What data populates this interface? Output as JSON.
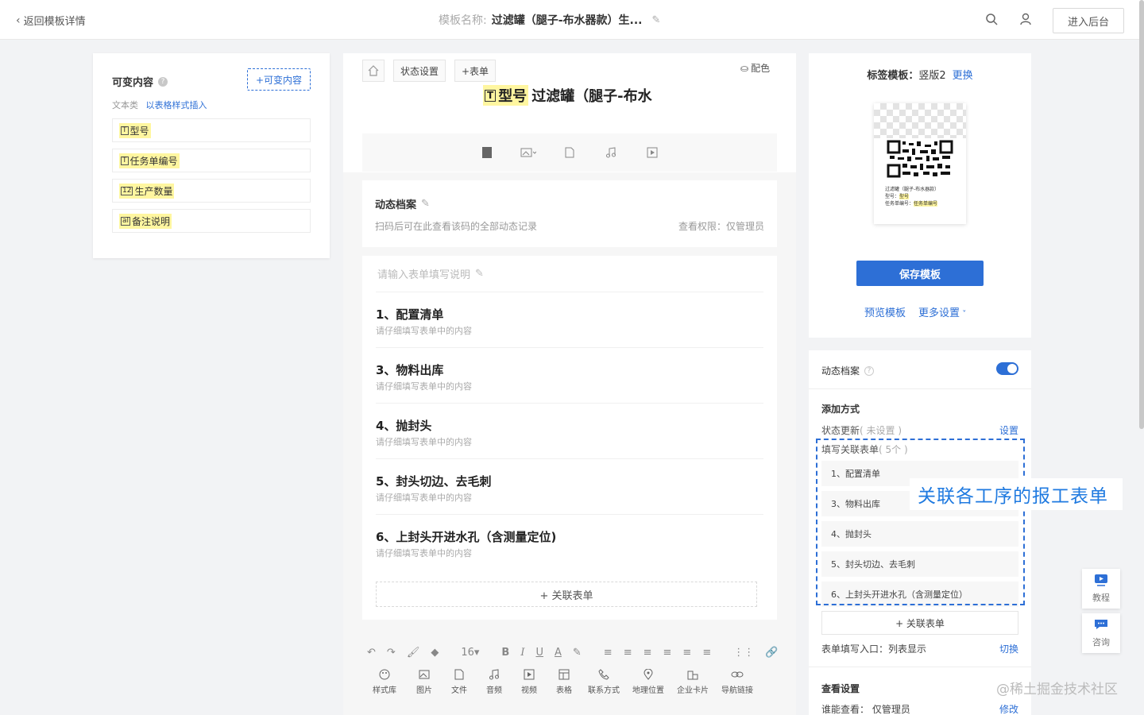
{
  "header": {
    "back_label": "返回模板详情",
    "template_name_label": "模板名称:",
    "template_name": "过滤罐（腿子-布水器款）生...",
    "enter_admin": "进入后台"
  },
  "variables_panel": {
    "title": "可变内容",
    "add_button": "+可变内容",
    "subtitle": "文本类",
    "insert_link": "以表格样式插入",
    "items": [
      {
        "icon": "T",
        "label": "型号"
      },
      {
        "icon": "T",
        "label": "任务单编号"
      },
      {
        "icon": "12",
        "label": "生产数量"
      },
      {
        "icon": "al",
        "label": "备注说明"
      }
    ]
  },
  "editor": {
    "tabs": [
      "状态设置",
      "+表单"
    ],
    "color_button": "配色",
    "title_var": "型号",
    "title_text": "过滤罐（腿子-布水",
    "dynamic_archive": {
      "title": "动态档案",
      "desc": "扫码后可在此查看该码的全部动态记录",
      "permission": "查看权限：仅管理员"
    },
    "forms_hint": "请输入表单填写说明",
    "forms": [
      {
        "title": "1、配置清单",
        "sub": "请仔细填写表单中的内容"
      },
      {
        "title": "3、物料出库",
        "sub": "请仔细填写表单中的内容"
      },
      {
        "title": "4、抛封头",
        "sub": "请仔细填写表单中的内容"
      },
      {
        "title": "5、封头切边、去毛刺",
        "sub": "请仔细填写表单中的内容"
      },
      {
        "title": "6、上封头开进水孔（含测量定位)",
        "sub": "请仔细填写表单中的内容"
      }
    ],
    "link_form_button": "+ 关联表单",
    "font_size": "16",
    "toolbar_items": [
      {
        "icon": "palette-icon",
        "label": "样式库"
      },
      {
        "icon": "image-icon",
        "label": "图片"
      },
      {
        "icon": "file-icon",
        "label": "文件"
      },
      {
        "icon": "music-icon",
        "label": "音频"
      },
      {
        "icon": "video-icon",
        "label": "视频"
      },
      {
        "icon": "table-icon",
        "label": "表格"
      },
      {
        "icon": "phone-icon",
        "label": "联系方式"
      },
      {
        "icon": "location-icon",
        "label": "地理位置"
      },
      {
        "icon": "business-card-icon",
        "label": "企业卡片"
      },
      {
        "icon": "link-icon",
        "label": "导航链接"
      }
    ]
  },
  "label_panel": {
    "template_label": "标签模板：",
    "template_value": "竖版2",
    "change_link": "更换",
    "preview_lines": [
      "过滤罐（腿子-布水器款）",
      "型号：",
      "型号",
      "任务单编号：",
      "任务单编号"
    ],
    "save_button": "保存模板",
    "preview_link": "预览模板",
    "more_settings": "更多设置"
  },
  "archive_panel": {
    "title": "动态档案",
    "toggle_on": true,
    "add_method_title": "添加方式",
    "status_update": "状态更新",
    "status_update_note": "( 未设置 )",
    "set_link": "设置",
    "linked_forms_label": "填写关联表单",
    "linked_forms_count": "( 5个 )",
    "linked_forms": [
      "1、配置清单",
      "3、物料出库",
      "4、抛封头",
      "5、封头切边、去毛刺",
      "6、上封头开进水孔（含测量定位）"
    ],
    "link_form_button": "+ 关联表单",
    "entry_label": "表单填写入口：列表显示",
    "switch_link": "切换",
    "view_settings_title": "查看设置",
    "who_can_view": "谁能查看：  仅管理员",
    "edit_link": "修改"
  },
  "annotation": "关联各工序的报工表单",
  "side_buttons": [
    {
      "icon": "tutorial-icon",
      "label": "教程"
    },
    {
      "icon": "chat-icon",
      "label": "咨询"
    }
  ],
  "watermark": "@稀土掘金技术社区",
  "colors": {
    "accent": "#2d6fd6",
    "highlight": "#fff6a0",
    "annotation": "#1f7ae0"
  }
}
